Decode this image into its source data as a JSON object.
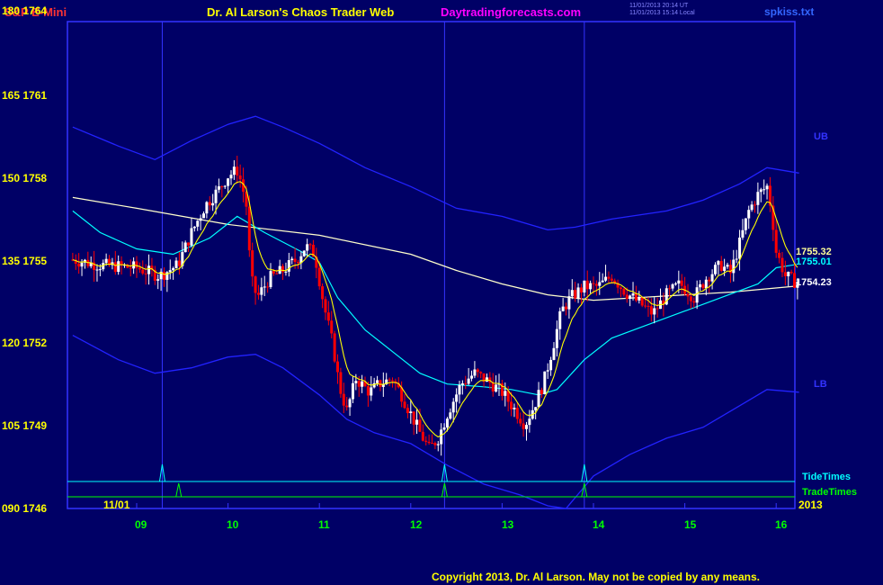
{
  "header": {
    "symbol": "S&P E-Mini",
    "title": "Dr. Al Larson's Chaos Trader Web",
    "site": "Daytradingforecasts.com",
    "file": "spkiss.txt",
    "time_ut": "11/01/2013 20:14 UT",
    "time_local": "11/01/2013 15:14 Local"
  },
  "footer": {
    "copyright": "Copyright 2013, Dr. Al Larson. May not be copied by any means."
  },
  "colors": {
    "background": "#000066",
    "frame": "#3333ff",
    "up_bar": "#ffffff",
    "down_bar": "#ff0000",
    "band": "#2222ff",
    "mid": "#ffffcc",
    "ema_fast": "#ffff00",
    "ema_slow": "#00ffff",
    "tide": "#00ffff",
    "trade": "#00ff00"
  },
  "chart_data": {
    "type": "line",
    "title": "S&P E-Mini",
    "ylim": [
      1746,
      1764
    ],
    "y_ticks": [
      "180 1764",
      "165 1761",
      "150 1758",
      "135 1755",
      "120 1752",
      "105 1749",
      "090 1746"
    ],
    "x_ticks": [
      "09",
      "10",
      "11",
      "12",
      "13",
      "14",
      "15",
      "16"
    ],
    "date_label": "11/01",
    "year_label": "2013",
    "price_labels": {
      "mid": "1755.32",
      "ema": "1755.01",
      "last": "1754.23"
    },
    "band_labels": {
      "upper": "UB",
      "lower": "LB"
    },
    "timing_labels": {
      "tide": "TideTimes",
      "trade": "TradeTimes"
    },
    "x_range": [
      8.3,
      16.25
    ],
    "tide_times": [
      9.28,
      12.37,
      13.9
    ],
    "trade_times": [
      9.46,
      12.37,
      13.9
    ],
    "close_anchors": [
      [
        8.3,
        1755.2
      ],
      [
        8.6,
        1755.0
      ],
      [
        9.0,
        1754.9
      ],
      [
        9.25,
        1754.6
      ],
      [
        9.45,
        1755.0
      ],
      [
        9.6,
        1756.2
      ],
      [
        9.75,
        1757.2
      ],
      [
        9.9,
        1757.8
      ],
      [
        10.0,
        1758.3
      ],
      [
        10.1,
        1758.5
      ],
      [
        10.15,
        1758.0
      ],
      [
        10.2,
        1757.2
      ],
      [
        10.25,
        1754.5
      ],
      [
        10.32,
        1753.8
      ],
      [
        10.45,
        1754.5
      ],
      [
        10.6,
        1754.8
      ],
      [
        10.75,
        1755.2
      ],
      [
        10.85,
        1755.7
      ],
      [
        10.95,
        1755.4
      ],
      [
        11.05,
        1753.5
      ],
      [
        11.15,
        1752.0
      ],
      [
        11.22,
        1750.5
      ],
      [
        11.3,
        1749.6
      ],
      [
        11.4,
        1750.8
      ],
      [
        11.55,
        1750.3
      ],
      [
        11.65,
        1750.6
      ],
      [
        11.8,
        1750.8
      ],
      [
        11.9,
        1750.2
      ],
      [
        12.0,
        1749.5
      ],
      [
        12.1,
        1748.8
      ],
      [
        12.2,
        1748.2
      ],
      [
        12.3,
        1748.6
      ],
      [
        12.4,
        1749.5
      ],
      [
        12.55,
        1750.6
      ],
      [
        12.7,
        1751.0
      ],
      [
        12.85,
        1750.7
      ],
      [
        13.0,
        1750.3
      ],
      [
        13.15,
        1749.6
      ],
      [
        13.25,
        1749.1
      ],
      [
        13.35,
        1749.8
      ],
      [
        13.45,
        1750.6
      ],
      [
        13.55,
        1751.9
      ],
      [
        13.65,
        1753.3
      ],
      [
        13.75,
        1753.8
      ],
      [
        13.9,
        1754.2
      ],
      [
        14.05,
        1754.2
      ],
      [
        14.2,
        1754.6
      ],
      [
        14.35,
        1754.0
      ],
      [
        14.5,
        1753.6
      ],
      [
        14.65,
        1753.2
      ],
      [
        14.8,
        1753.9
      ],
      [
        14.95,
        1754.3
      ],
      [
        15.1,
        1753.8
      ],
      [
        15.25,
        1754.6
      ],
      [
        15.4,
        1755.0
      ],
      [
        15.5,
        1754.7
      ],
      [
        15.6,
        1755.8
      ],
      [
        15.7,
        1757.0
      ],
      [
        15.8,
        1757.6
      ],
      [
        15.9,
        1757.9
      ],
      [
        15.95,
        1757.0
      ],
      [
        16.0,
        1755.5
      ],
      [
        16.1,
        1754.6
      ],
      [
        16.2,
        1754.4
      ]
    ],
    "mid_line": [
      [
        8.3,
        1757.5
      ],
      [
        9.0,
        1757.1
      ],
      [
        10.0,
        1756.5
      ],
      [
        11.0,
        1756.1
      ],
      [
        12.0,
        1755.4
      ],
      [
        12.5,
        1754.8
      ],
      [
        13.0,
        1754.3
      ],
      [
        13.5,
        1753.9
      ],
      [
        14.0,
        1753.7
      ],
      [
        15.0,
        1753.9
      ],
      [
        15.5,
        1754.0
      ],
      [
        16.25,
        1754.23
      ]
    ],
    "upper_band": [
      [
        8.3,
        1760.1
      ],
      [
        8.8,
        1759.4
      ],
      [
        9.2,
        1758.9
      ],
      [
        9.6,
        1759.6
      ],
      [
        10.0,
        1760.2
      ],
      [
        10.3,
        1760.5
      ],
      [
        10.6,
        1760.1
      ],
      [
        11.0,
        1759.5
      ],
      [
        11.5,
        1758.6
      ],
      [
        12.0,
        1757.9
      ],
      [
        12.5,
        1757.1
      ],
      [
        13.0,
        1756.8
      ],
      [
        13.5,
        1756.3
      ],
      [
        13.8,
        1756.4
      ],
      [
        14.2,
        1756.7
      ],
      [
        14.8,
        1757.0
      ],
      [
        15.2,
        1757.4
      ],
      [
        15.6,
        1758.0
      ],
      [
        15.9,
        1758.6
      ],
      [
        16.25,
        1758.4
      ]
    ],
    "lower_band": [
      [
        8.3,
        1752.4
      ],
      [
        8.8,
        1751.5
      ],
      [
        9.2,
        1751.0
      ],
      [
        9.6,
        1751.2
      ],
      [
        10.0,
        1751.6
      ],
      [
        10.3,
        1751.7
      ],
      [
        10.6,
        1751.2
      ],
      [
        11.0,
        1750.2
      ],
      [
        11.3,
        1749.3
      ],
      [
        11.6,
        1748.8
      ],
      [
        12.0,
        1748.4
      ],
      [
        12.4,
        1747.6
      ],
      [
        12.8,
        1746.9
      ],
      [
        13.2,
        1746.5
      ],
      [
        13.5,
        1746.1
      ],
      [
        13.7,
        1746.0
      ],
      [
        14.0,
        1747.2
      ],
      [
        14.4,
        1748.0
      ],
      [
        14.8,
        1748.6
      ],
      [
        15.2,
        1749.0
      ],
      [
        15.6,
        1749.8
      ],
      [
        15.9,
        1750.4
      ],
      [
        16.25,
        1750.3
      ]
    ],
    "ema_slow": [
      [
        8.3,
        1757.0
      ],
      [
        8.6,
        1756.2
      ],
      [
        9.0,
        1755.6
      ],
      [
        9.4,
        1755.4
      ],
      [
        9.8,
        1756.0
      ],
      [
        10.1,
        1756.8
      ],
      [
        10.4,
        1756.2
      ],
      [
        10.8,
        1755.5
      ],
      [
        11.0,
        1755.1
      ],
      [
        11.2,
        1753.8
      ],
      [
        11.5,
        1752.6
      ],
      [
        11.8,
        1751.8
      ],
      [
        12.1,
        1751.0
      ],
      [
        12.4,
        1750.6
      ],
      [
        12.8,
        1750.5
      ],
      [
        13.1,
        1750.4
      ],
      [
        13.4,
        1750.2
      ],
      [
        13.6,
        1750.4
      ],
      [
        13.9,
        1751.5
      ],
      [
        14.2,
        1752.3
      ],
      [
        14.6,
        1752.8
      ],
      [
        15.0,
        1753.3
      ],
      [
        15.4,
        1753.8
      ],
      [
        15.8,
        1754.3
      ],
      [
        16.0,
        1754.9
      ],
      [
        16.2,
        1755.01
      ]
    ]
  }
}
